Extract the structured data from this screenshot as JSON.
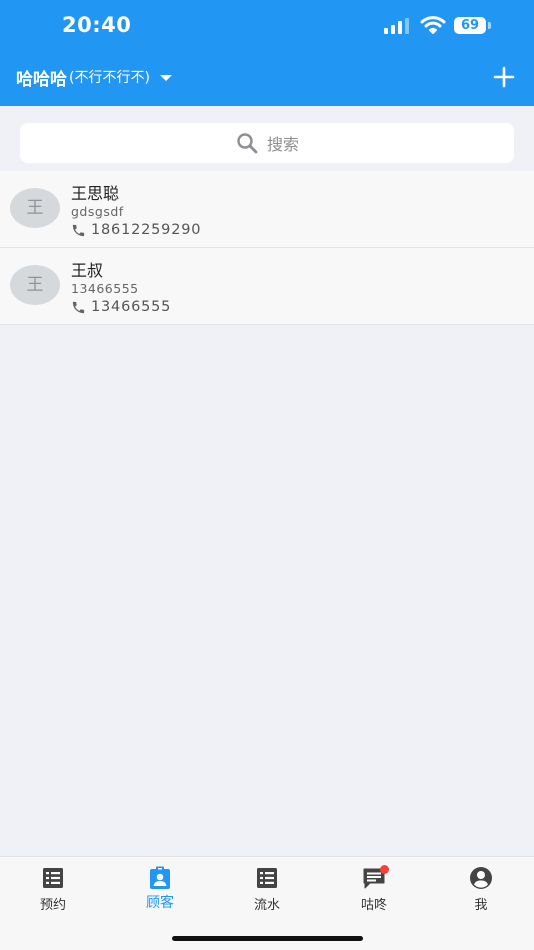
{
  "status_bar": {
    "time": "20:40",
    "battery": "69"
  },
  "header": {
    "shop_name": "哈哈哈",
    "shop_sub": "(不行不行不)"
  },
  "search": {
    "placeholder": "搜索"
  },
  "customers": [
    {
      "avatar": "王",
      "name": "王思聪",
      "note": "gdsgsdf",
      "phone": "18612259290"
    },
    {
      "avatar": "王",
      "name": "王叔",
      "note": "13466555",
      "phone": "13466555"
    }
  ],
  "tabs": [
    {
      "label": "预约",
      "icon": "list-icon"
    },
    {
      "label": "顾客",
      "icon": "contact-icon",
      "active": true
    },
    {
      "label": "流水",
      "icon": "list-icon"
    },
    {
      "label": "咕咚",
      "icon": "message-icon",
      "badge": true
    },
    {
      "label": "我",
      "icon": "person-icon"
    }
  ],
  "colors": {
    "primary": "#2196f3",
    "background": "#f0f1f6",
    "badge": "#f44336"
  }
}
